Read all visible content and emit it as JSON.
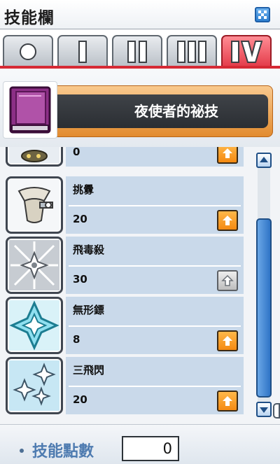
{
  "window": {
    "title": "技能欄",
    "close_icon": "close-icon"
  },
  "tabs": [
    {
      "label": "○",
      "icon": "circle-icon",
      "active": false
    },
    {
      "label": "I",
      "icon": "roman-1-icon",
      "active": false
    },
    {
      "label": "II",
      "icon": "roman-2-icon",
      "active": false
    },
    {
      "label": "III",
      "icon": "roman-3-icon",
      "active": false
    },
    {
      "label": "IV",
      "icon": "roman-4-icon",
      "active": true
    }
  ],
  "job": {
    "name": "夜使者的祕技",
    "icon": "purple-skill-book-icon"
  },
  "skills": [
    {
      "name": "",
      "level": "0",
      "icon": "partial-skill-icon",
      "can_add": true
    },
    {
      "name": "挑釁",
      "level": "20",
      "icon": "taunt-scroll-icon",
      "can_add": true
    },
    {
      "name": "飛毒殺",
      "level": "30",
      "icon": "star-burst-icon",
      "can_add": false
    },
    {
      "name": "無形鏢",
      "level": "8",
      "icon": "shadow-star-icon",
      "can_add": true
    },
    {
      "name": "三飛閃",
      "level": "20",
      "icon": "triple-throw-icon",
      "can_add": true
    }
  ],
  "footer": {
    "label": "技能點數",
    "points": "0"
  },
  "colors": {
    "accent": "#4e7bb0",
    "active_tab": "#e33a48",
    "plus_button": "#f48a12",
    "skill_bg": "#c9d9ea"
  }
}
